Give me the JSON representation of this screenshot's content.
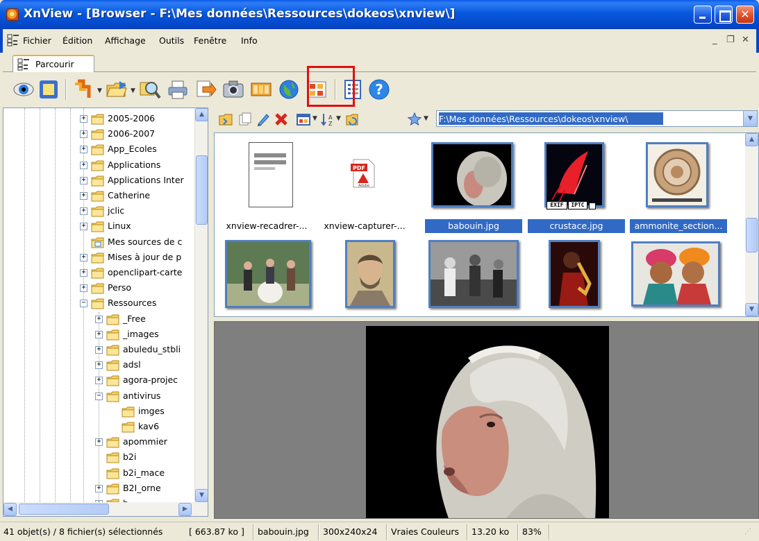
{
  "window": {
    "title": "XnView - [Browser - F:\\Mes données\\Ressources\\dokeos\\xnview\\]"
  },
  "menu": {
    "items": [
      "Fichier",
      "Édition",
      "Affichage",
      "Outils",
      "Fenêtre",
      "Info"
    ]
  },
  "tab": {
    "label": "Parcourir"
  },
  "tree": {
    "items": [
      {
        "label": "2005-2006",
        "expander": "+"
      },
      {
        "label": "2006-2007",
        "expander": "+"
      },
      {
        "label": "App_Ecoles",
        "expander": "+"
      },
      {
        "label": "Applications",
        "expander": "+"
      },
      {
        "label": "Applications Inter",
        "expander": "+"
      },
      {
        "label": "Catherine",
        "expander": "+"
      },
      {
        "label": "jclic",
        "expander": "+"
      },
      {
        "label": "Linux",
        "expander": "+"
      },
      {
        "label": "Mes sources de c",
        "expander": ""
      },
      {
        "label": "Mises à jour de p",
        "expander": "+"
      },
      {
        "label": "openclipart-carte",
        "expander": "+"
      },
      {
        "label": "Perso",
        "expander": "+"
      },
      {
        "label": "Ressources",
        "expander": "−"
      },
      {
        "label": "_Free",
        "expander": "+"
      },
      {
        "label": "_images",
        "expander": "+"
      },
      {
        "label": "abuledu_stbli",
        "expander": "+"
      },
      {
        "label": "adsl",
        "expander": "+"
      },
      {
        "label": "agora-projec",
        "expander": "+"
      },
      {
        "label": "antivirus",
        "expander": "−"
      },
      {
        "label": "imges",
        "expander": ""
      },
      {
        "label": "kav6",
        "expander": ""
      },
      {
        "label": "apommier",
        "expander": "+"
      },
      {
        "label": "b2i",
        "expander": ""
      },
      {
        "label": "b2i_mace",
        "expander": ""
      },
      {
        "label": "B2I_orne",
        "expander": "+"
      },
      {
        "label": "b",
        "expander": "+"
      }
    ]
  },
  "browser": {
    "path": "F:\\Mes données\\Ressources\\dokeos\\xnview\\"
  },
  "thumbnails": [
    {
      "caption": "xnview-recadrer-...",
      "selected": false
    },
    {
      "caption": "xnview-capturer-...",
      "selected": false
    },
    {
      "caption": "babouin.jpg",
      "selected": true
    },
    {
      "caption": "crustace.jpg",
      "selected": true
    },
    {
      "caption": "ammonite_section...",
      "selected": true
    },
    {
      "caption": "",
      "selected": true
    },
    {
      "caption": "",
      "selected": true
    },
    {
      "caption": "",
      "selected": true
    },
    {
      "caption": "",
      "selected": true
    },
    {
      "caption": "",
      "selected": true
    }
  ],
  "badges": {
    "exif": "EXIF",
    "iptc": "IPTC"
  },
  "status": {
    "objects": "41 objet(s) / 8 fichier(s) sélectionnés",
    "size": "[ 663.87 ko ]",
    "filename": "babouin.jpg",
    "dimensions": "300x240x24",
    "colors": "Vraies Couleurs",
    "filesize": "13.20 ko",
    "zoom": "83%"
  },
  "colors": {
    "titlebar": "#0446c8",
    "selection": "#316ac5",
    "highlight": "#e01010"
  },
  "icons": {
    "toolbar": [
      "view-icon",
      "fullscreen-icon",
      "convert-icon",
      "open-icon",
      "find-icon",
      "print-icon",
      "export-icon",
      "capture-icon",
      "slideshow-icon",
      "web-page-icon",
      "contact-sheet-icon",
      "properties-icon",
      "help-icon"
    ]
  }
}
